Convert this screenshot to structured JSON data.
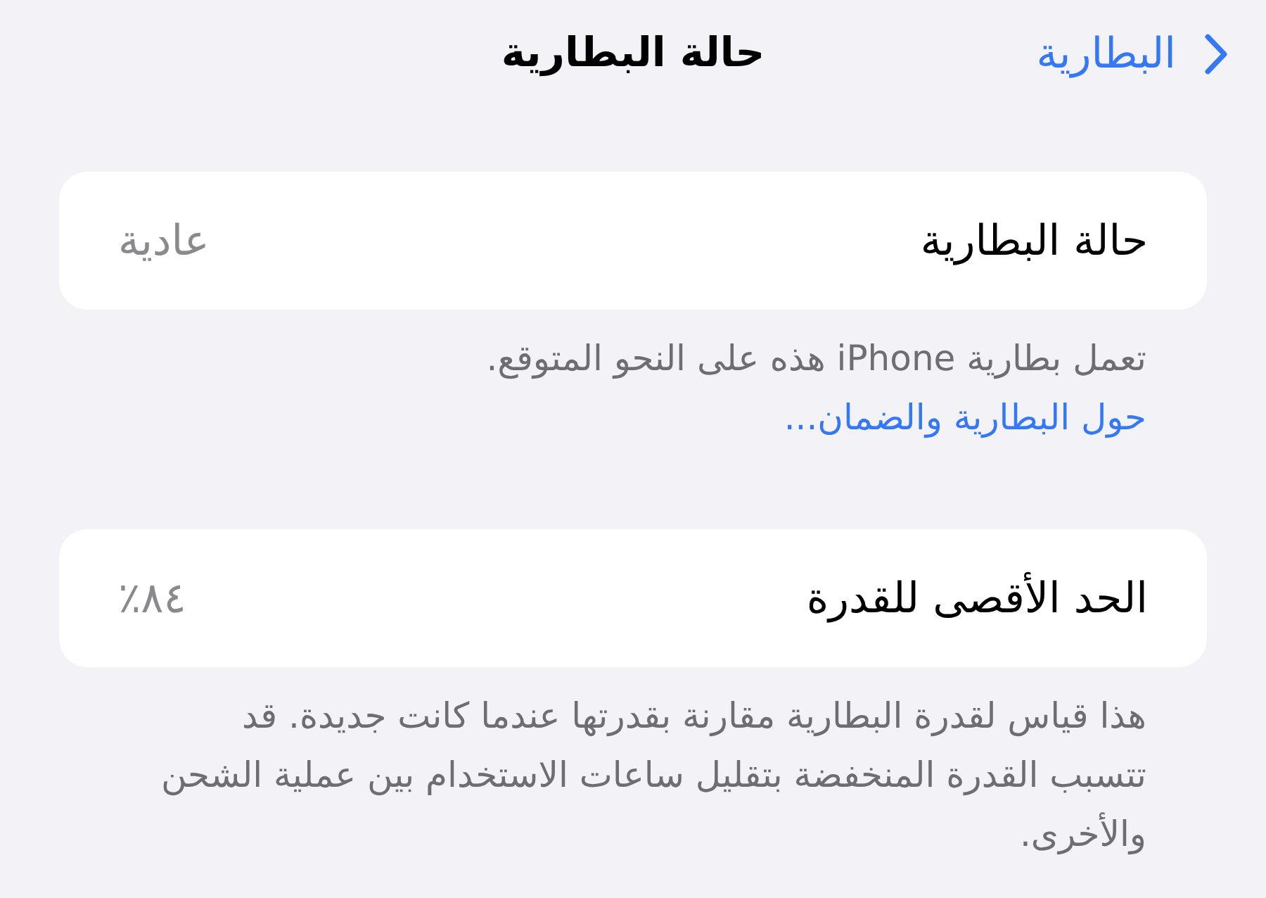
{
  "nav_bar": {
    "back_label": "البطارية",
    "title": "حالة البطارية"
  },
  "sections": [
    {
      "rows": [
        {
          "label": "حالة البطارية",
          "value": "عادية"
        }
      ],
      "footer": {
        "text": "تعمل بطارية iPhone هذه على النحو المتوقع.",
        "link": "حول البطارية والضمان..."
      }
    },
    {
      "rows": [
        {
          "label": "الحد الأقصى للقدرة",
          "value": "٨٤٪"
        }
      ],
      "footer": {
        "text": "هذا قياس لقدرة البطارية مقارنة بقدرتها عندما كانت جديدة. قد تتسبب القدرة المنخفضة بتقليل ساعات الاستخدام بين عملية الشحن والأخرى."
      }
    }
  ]
}
